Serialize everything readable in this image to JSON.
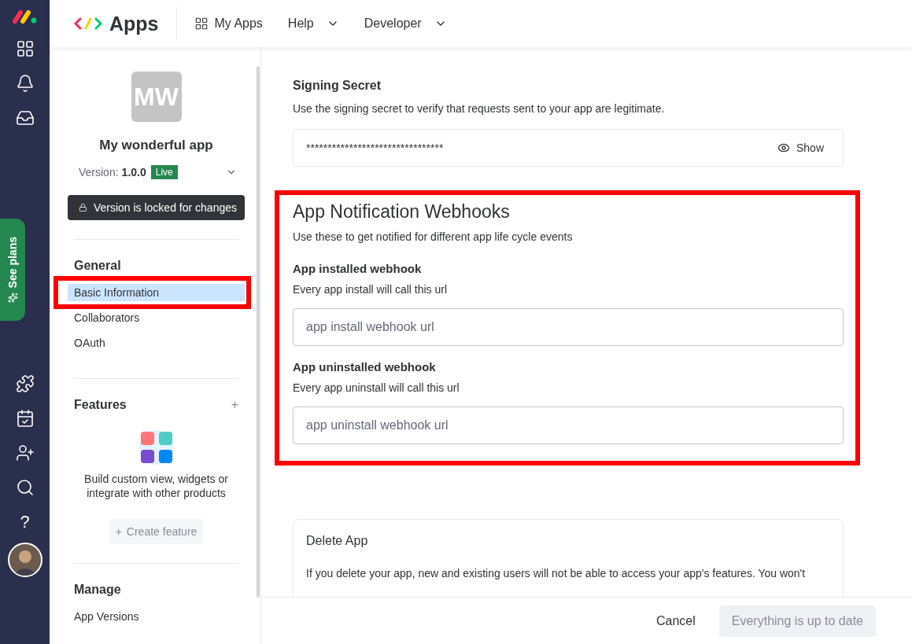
{
  "rail": {
    "items": [
      {
        "kind": "grid"
      },
      {
        "kind": "bell"
      },
      {
        "kind": "inbox"
      }
    ],
    "plans_label": "See plans",
    "bottom_items": [
      {
        "kind": "puzzle"
      },
      {
        "kind": "calendar"
      },
      {
        "kind": "invite"
      },
      {
        "kind": "search"
      },
      {
        "kind": "help",
        "label": "?"
      }
    ]
  },
  "topbar": {
    "logo": "Apps",
    "nav": [
      {
        "label": "My Apps",
        "kind": "grid"
      },
      {
        "label": "Help",
        "kind": "dropdown"
      },
      {
        "label": "Developer",
        "kind": "dropdown"
      }
    ]
  },
  "sidebar": {
    "initials": "MW",
    "app_name": "My wonderful app",
    "version_label": "Version:",
    "version": "1.0.0",
    "status": "Live",
    "lock_notice": "Version is locked for changes",
    "sections": [
      {
        "title": "General",
        "items": [
          {
            "label": "Basic Information",
            "selected": true
          },
          {
            "label": "Collaborators",
            "selected": false
          },
          {
            "label": "OAuth",
            "selected": false
          }
        ]
      },
      {
        "title": "Features",
        "add": "+",
        "empty_text": "Build custom view, widgets or integrate with other products",
        "action": "Create feature",
        "action_icon": "+"
      },
      {
        "title": "Manage",
        "items": [
          {
            "label": "App Versions",
            "selected": false
          }
        ]
      }
    ]
  },
  "signing_secret": {
    "title": "Signing Secret",
    "description": "Use the signing secret to verify that requests sent to your app are legitimate.",
    "value": "********************************",
    "show_label": "Show"
  },
  "webhooks": {
    "title": "App Notification Webhooks",
    "description": "Use these to get notified for different app life cycle events",
    "highlighted": true,
    "fields": [
      {
        "label": "App installed webhook",
        "hint": "Every app install will call this url",
        "placeholder": "app install webhook url"
      },
      {
        "label": "App uninstalled webhook",
        "hint": "Every app uninstall will call this url",
        "placeholder": "app uninstall webhook url"
      }
    ]
  },
  "delete_app": {
    "title": "Delete App",
    "text": "If you delete your app, new and existing users will not be able to access your app's features. You won't"
  },
  "footer": {
    "cancel": "Cancel",
    "save": "Everything is up to date",
    "save_disabled": true
  }
}
